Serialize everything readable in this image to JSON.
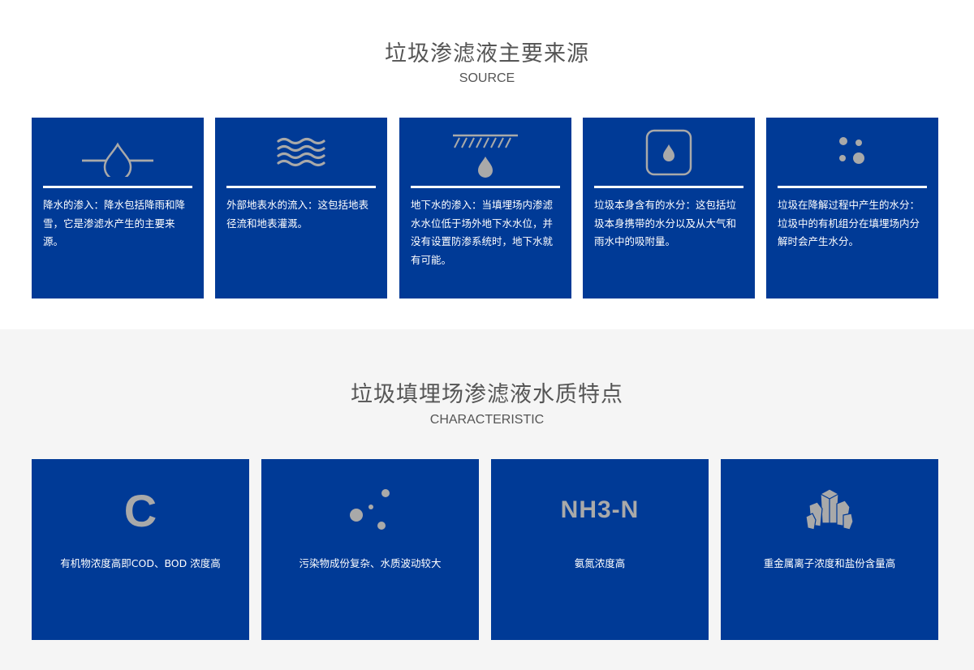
{
  "source_section": {
    "title": "垃圾渗滤液主要来源",
    "subtitle": "SOURCE",
    "cards": [
      {
        "icon": "water-drop-line-icon",
        "text": "降水的渗入：降水包括降雨和降雪，它是渗滤水产生的主要来源。"
      },
      {
        "icon": "waves-icon",
        "text": "外部地表水的流入：这包括地表径流和地表灌溉。"
      },
      {
        "icon": "underground-drop-icon",
        "text": "地下水的渗入：当填埋场内渗滤水水位低于场外地下水水位，并没有设置防渗系统时，地下水就有可能。"
      },
      {
        "icon": "boxed-drop-icon",
        "text": "垃圾本身含有的水分：这包括垃圾本身携带的水分以及从大气和雨水中的吸附量。"
      },
      {
        "icon": "dots-icon",
        "text": "垃圾在降解过程中产生的水分：垃圾中的有机组分在填埋场内分解时会产生水分。"
      }
    ]
  },
  "characteristic_section": {
    "title": "垃圾填埋场渗滤液水质特点",
    "subtitle": "CHARACTERISTIC",
    "cards": [
      {
        "icon": "letter-c-icon",
        "icon_text": "C",
        "text": "有机物浓度高即COD、BOD 浓度高"
      },
      {
        "icon": "scattered-dots-icon",
        "text": "污染物成份复杂、水质波动较大"
      },
      {
        "icon": "nh3n-icon",
        "icon_text": "NH3-N",
        "text": "氨氮浓度高"
      },
      {
        "icon": "crystal-icon",
        "text": "重金属离子浓度和盐份含量高"
      }
    ]
  },
  "colors": {
    "card_bg": "#003a96",
    "icon_gray": "#a9a9a9",
    "section_bg_alt": "#f5f5f5"
  }
}
